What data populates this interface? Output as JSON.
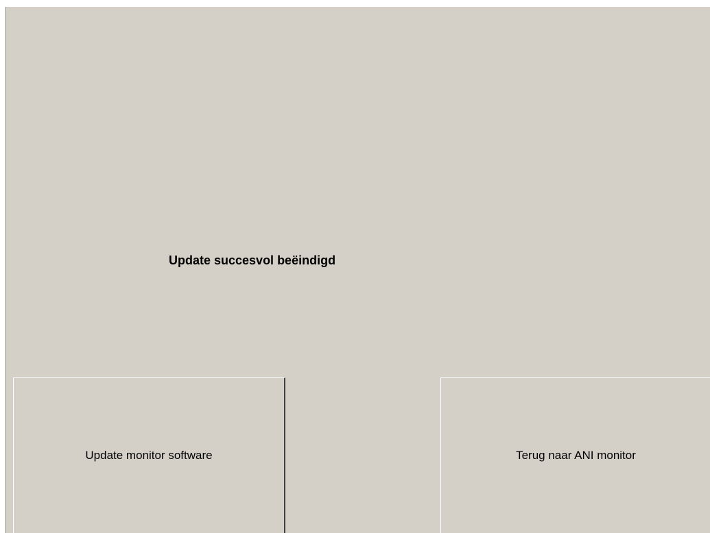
{
  "status": {
    "message": "Update succesvol beëindigd"
  },
  "buttons": {
    "update_label": "Update monitor software",
    "back_label": "Terug naar ANI monitor"
  },
  "colors": {
    "background": "#d4d0c8",
    "text": "#000000"
  }
}
